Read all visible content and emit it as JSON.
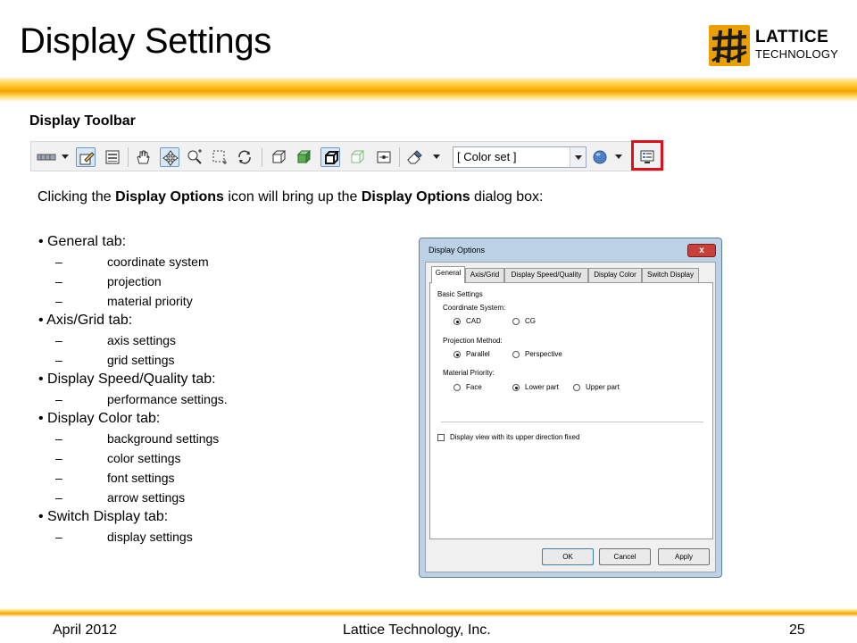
{
  "slide": {
    "title": "Display Settings",
    "logo": {
      "line1": "LATTICE",
      "line2": "TECHNOLOGY"
    },
    "section_heading": "Display Toolbar"
  },
  "toolbar": {
    "color_set": "[ Color set ]",
    "icons": [
      "select-mode-icon",
      "edit-icon",
      "panel-icon",
      "hand-icon",
      "move-icon",
      "zoom-icon",
      "box-select-icon",
      "rotate-icon",
      "wireframe-cube-icon",
      "shaded-cube-icon",
      "outline-cube-icon",
      "hidden-line-cube-icon",
      "center-icon",
      "eraser-icon",
      "sphere-icon",
      "display-options-icon"
    ],
    "highlight_color": "#e0101a"
  },
  "intro": {
    "part1": "Clicking the ",
    "bold1": "Display Options",
    "part2": " icon will bring up the ",
    "bold2": "Display Options",
    "part3": " dialog box:"
  },
  "outline": {
    "bullet_general": "• General tab:",
    "general_1": "coordinate system",
    "general_2": "projection",
    "general_3": "material priority",
    "bullet_axis": "• Axis/Grid tab:",
    "axis_1": "axis settings",
    "axis_2": "grid settings",
    "bullet_speed": "• Display Speed/Quality tab:",
    "speed_1": "performance settings.",
    "bullet_color": "• Display Color tab:",
    "color_1": "background settings",
    "color_2": "color settings",
    "color_3": "font settings",
    "color_4": "arrow settings",
    "bullet_switch": "• Switch Display tab:",
    "switch_1": "display settings",
    "dash": "–"
  },
  "dialog": {
    "title": "Display Options",
    "close": "x",
    "tabs": [
      "General",
      "Axis/Grid",
      "Display Speed/Quality",
      "Display Color",
      "Switch Display"
    ],
    "basic_settings": "Basic Settings",
    "coordinate_system": "Coordinate System:",
    "cad": "CAD",
    "cg": "CG",
    "projection_method": "Projection Method:",
    "parallel": "Parallel",
    "perspective": "Perspective",
    "material_priority": "Material Priority:",
    "face": "Face",
    "lower_part": "Lower part",
    "upper_part": "Upper part",
    "fixed_direction": "Display view with its upper direction fixed",
    "ok": "OK",
    "cancel": "Cancel",
    "apply": "Apply"
  },
  "footer": {
    "date": "April 2012",
    "company": "Lattice Technology, Inc.",
    "page": "25"
  }
}
